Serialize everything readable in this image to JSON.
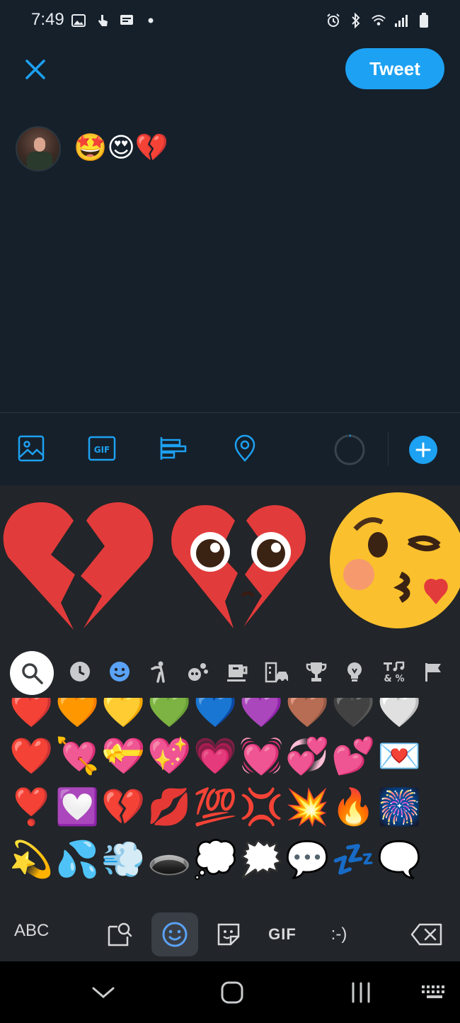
{
  "status_bar": {
    "time": "7:49"
  },
  "compose": {
    "tweet_label": "Tweet",
    "text": "🤩😍💔"
  },
  "emoji_suggestions": [
    "💔",
    "🥺💔",
    "😘"
  ],
  "emoji_grid": {
    "rows": [
      [
        "❤️",
        "🧡",
        "💛",
        "💚",
        "💙",
        "💜",
        "🤎",
        "🖤",
        "🤍"
      ],
      [
        "❤️",
        "💘",
        "💝",
        "💖",
        "💗",
        "💓",
        "💞",
        "💕",
        "💌"
      ],
      [
        "❣️",
        "💟",
        "💔",
        "💋",
        "💯",
        "💢",
        "💥",
        "🔥",
        "🎆"
      ],
      [
        "💫",
        "💦",
        "💨",
        "🕳️",
        "💭",
        "🗯️",
        "💬",
        "💤",
        "🗨️"
      ]
    ]
  },
  "keyboard": {
    "abc_label": "ABC",
    "gif_label": "GIF",
    "emoticon_label": ":-)"
  },
  "colors": {
    "accent": "#1da1f2",
    "background": "#15202b",
    "keyboard_bg": "#222529"
  },
  "icons": {
    "close": "close-icon",
    "image": "image-icon",
    "gif": "gif-icon",
    "poll": "poll-icon",
    "location": "location-icon",
    "add": "plus-icon"
  }
}
